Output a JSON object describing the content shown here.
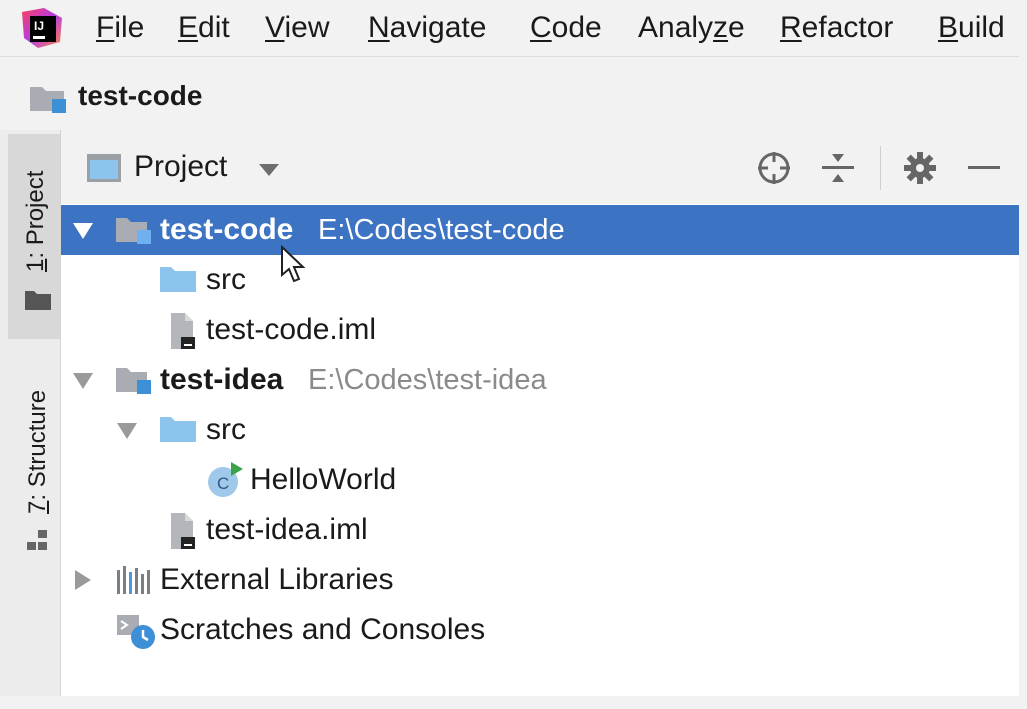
{
  "menu": {
    "items": [
      {
        "mnemonic": "F",
        "rest": "ile"
      },
      {
        "mnemonic": "E",
        "rest": "dit"
      },
      {
        "mnemonic": "V",
        "rest": "iew"
      },
      {
        "mnemonic": "N",
        "rest": "avigate"
      },
      {
        "mnemonic": "C",
        "rest": "ode"
      },
      {
        "pre": "Analy",
        "mnemonic": "z",
        "rest": "e"
      },
      {
        "mnemonic": "R",
        "rest": "efactor"
      },
      {
        "mnemonic": "B",
        "rest": "uild"
      }
    ]
  },
  "navbar": {
    "title": "test-code"
  },
  "stripe": {
    "project": {
      "mnemonic": "1",
      "rest": ": Project"
    },
    "structure": {
      "mnemonic": "7",
      "rest": ": Structure"
    }
  },
  "panel": {
    "view_label": "Project",
    "icons": [
      "locate-icon",
      "collapse-all-icon",
      "gear-icon",
      "minimize-icon"
    ]
  },
  "tree": {
    "rows": [
      {
        "label": "test-code",
        "path": "E:\\Codes\\test-code",
        "selected": true,
        "expanded": true,
        "icon": "module-folder-icon"
      },
      {
        "label": "src",
        "icon": "source-folder-icon"
      },
      {
        "label": "test-code.iml",
        "icon": "iml-file-icon"
      },
      {
        "label": "test-idea",
        "path": "E:\\Codes\\test-idea",
        "expanded": true,
        "icon": "module-folder-icon"
      },
      {
        "label": "src",
        "expanded": true,
        "icon": "source-folder-icon"
      },
      {
        "label": "HelloWorld",
        "icon": "java-class-icon"
      },
      {
        "label": "test-idea.iml",
        "icon": "iml-file-icon"
      },
      {
        "label": "External Libraries",
        "expanded": false,
        "icon": "libraries-icon"
      },
      {
        "label": "Scratches and Consoles",
        "icon": "scratches-icon"
      }
    ]
  },
  "colors": {
    "selection": "#3d73c3",
    "folder_blue": "#8cc4ee",
    "accent_blue": "#3d8fd6"
  }
}
